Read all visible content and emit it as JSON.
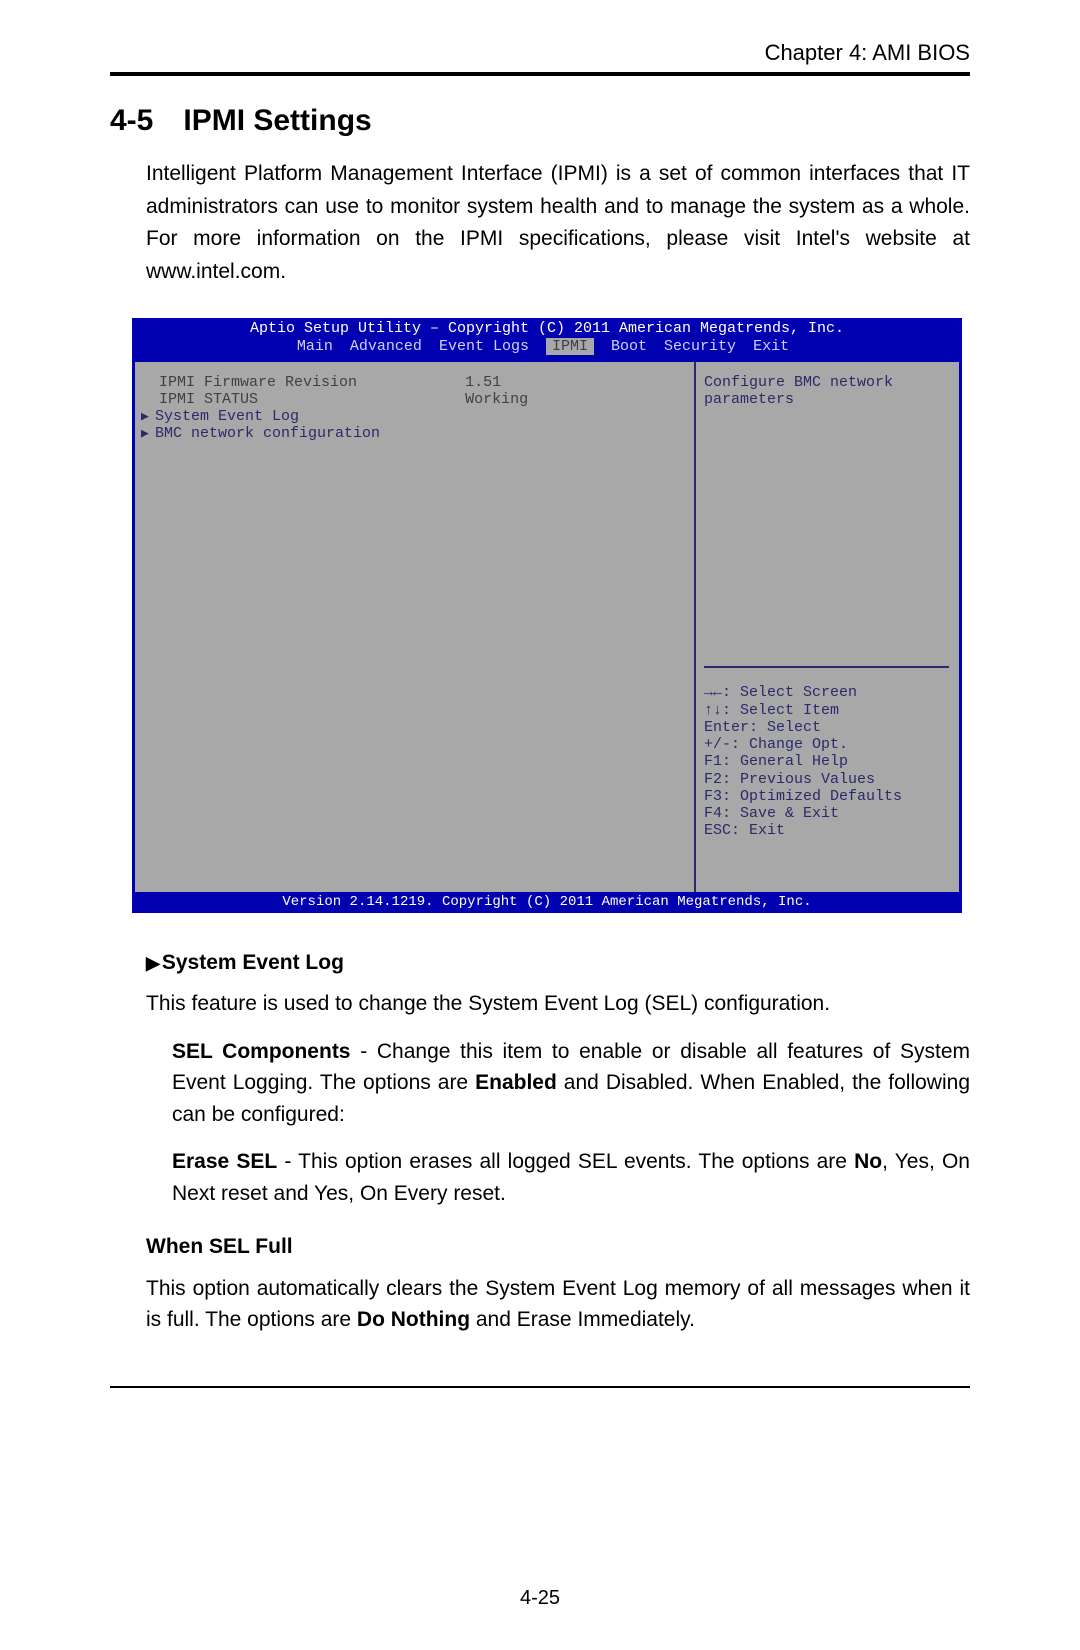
{
  "chapter_header": "Chapter 4: AMI BIOS",
  "section": {
    "num": "4-5",
    "title": "IPMI Settings"
  },
  "intro_paragraph": "Intelligent Platform Management Interface (IPMI) is a set of common interfaces that IT administrators can use to monitor system health and to manage the system as a whole. For more information on the IPMI specifications, please visit Intel's website at www.intel.com.",
  "bios": {
    "title_bar": "Aptio Setup Utility – Copyright (C) 2011 American Megatrends, Inc.",
    "tabs": [
      "Main",
      "Advanced",
      "Event Logs",
      "IPMI",
      "Boot",
      "Security",
      "Exit"
    ],
    "active_tab": "IPMI",
    "left": {
      "firmware_label": "IPMI Firmware Revision",
      "firmware_value": "1.51",
      "status_label": "IPMI STATUS",
      "status_value": "Working",
      "item_sel": "System Event Log",
      "item_bmc": "BMC network configuration"
    },
    "help_text_l1": "Configure BMC network",
    "help_text_l2": "parameters",
    "keys": {
      "k1": "→←: Select Screen",
      "k2": "↑↓: Select Item",
      "k3": "Enter: Select",
      "k4": "+/-: Change Opt.",
      "k5": "F1: General Help",
      "k6": "F2: Previous Values",
      "k7": "F3: Optimized Defaults",
      "k8": "F4: Save & Exit",
      "k9": "ESC: Exit"
    },
    "footer_bar": "Version 2.14.1219. Copyright (C) 2011 American Megatrends, Inc."
  },
  "body": {
    "sel_heading": "System Event Log",
    "sel_para": "This feature is used to change the System Event Log (SEL) configuration.",
    "sel_components_lead": "SEL Components",
    "sel_components_rest": " - Change this item to enable or disable all features of System Event Logging. The options are ",
    "sel_components_enabled": "Enabled",
    "sel_components_tail": " and Disabled. When Enabled, the following can be configured:",
    "erase_lead": "Erase SEL",
    "erase_rest_a": " - This option erases all logged SEL events. The options are ",
    "erase_no": "No",
    "erase_rest_b": ", Yes, On Next reset and Yes, On Every reset.",
    "when_heading": "When SEL Full",
    "when_para_a": "This option automatically clears the System Event Log memory of all messages when it is full. The options are ",
    "when_bold": "Do Nothing",
    "when_para_b": " and Erase Immediately."
  },
  "page_number": "4-25"
}
